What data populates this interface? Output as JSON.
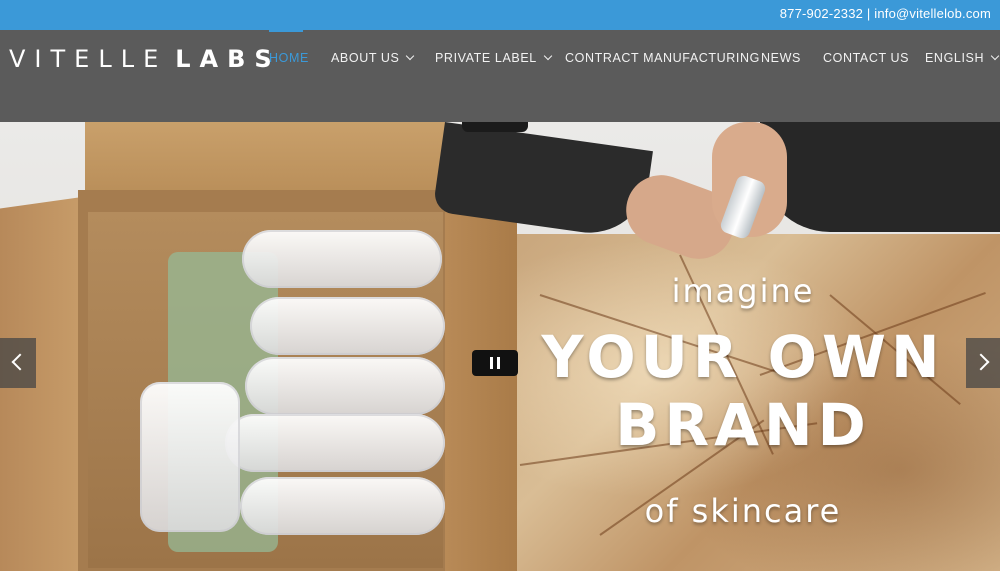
{
  "topbar": {
    "contact": "877-902-2332 | info@vitellelob.com",
    "bg_color": "#3b99d8"
  },
  "brand": {
    "logo_light": "VITELLE",
    "logo_bold": "LABS"
  },
  "nav": {
    "items": [
      {
        "label": "HOME",
        "active": true,
        "dropdown": false
      },
      {
        "label": "ABOUT US",
        "active": false,
        "dropdown": true
      },
      {
        "label": "PRIVATE LABEL",
        "active": false,
        "dropdown": true
      },
      {
        "label": "CONTRACT MANUFACTURING",
        "active": false,
        "dropdown": false
      },
      {
        "label": "NEWS",
        "active": false,
        "dropdown": false
      },
      {
        "label": "CONTACT US",
        "active": false,
        "dropdown": false
      },
      {
        "label": "ENGLISH",
        "active": false,
        "dropdown": true
      }
    ],
    "accent_color": "#3b99d8"
  },
  "hero": {
    "line1": "imagine",
    "line2": "YOUR OWN",
    "line3": "BRAND",
    "line4": "of skincare",
    "icons": {
      "prev": "chevron-left-icon",
      "next": "chevron-right-icon",
      "pause": "pause-icon"
    }
  }
}
